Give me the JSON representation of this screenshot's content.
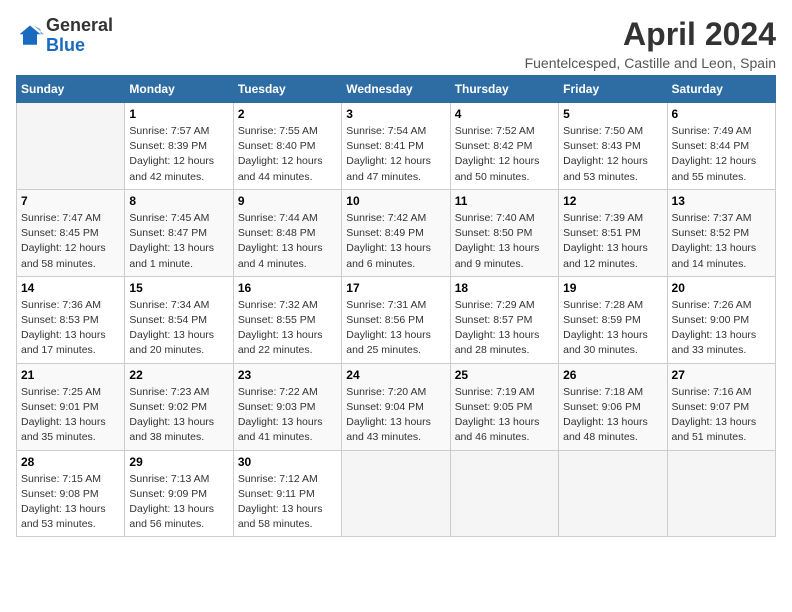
{
  "logo": {
    "general": "General",
    "blue": "Blue"
  },
  "header": {
    "title": "April 2024",
    "subtitle": "Fuentelcesped, Castille and Leon, Spain"
  },
  "weekdays": [
    "Sunday",
    "Monday",
    "Tuesday",
    "Wednesday",
    "Thursday",
    "Friday",
    "Saturday"
  ],
  "weeks": [
    [
      {
        "day": "",
        "info": ""
      },
      {
        "day": "1",
        "info": "Sunrise: 7:57 AM\nSunset: 8:39 PM\nDaylight: 12 hours\nand 42 minutes."
      },
      {
        "day": "2",
        "info": "Sunrise: 7:55 AM\nSunset: 8:40 PM\nDaylight: 12 hours\nand 44 minutes."
      },
      {
        "day": "3",
        "info": "Sunrise: 7:54 AM\nSunset: 8:41 PM\nDaylight: 12 hours\nand 47 minutes."
      },
      {
        "day": "4",
        "info": "Sunrise: 7:52 AM\nSunset: 8:42 PM\nDaylight: 12 hours\nand 50 minutes."
      },
      {
        "day": "5",
        "info": "Sunrise: 7:50 AM\nSunset: 8:43 PM\nDaylight: 12 hours\nand 53 minutes."
      },
      {
        "day": "6",
        "info": "Sunrise: 7:49 AM\nSunset: 8:44 PM\nDaylight: 12 hours\nand 55 minutes."
      }
    ],
    [
      {
        "day": "7",
        "info": "Sunrise: 7:47 AM\nSunset: 8:45 PM\nDaylight: 12 hours\nand 58 minutes."
      },
      {
        "day": "8",
        "info": "Sunrise: 7:45 AM\nSunset: 8:47 PM\nDaylight: 13 hours\nand 1 minute."
      },
      {
        "day": "9",
        "info": "Sunrise: 7:44 AM\nSunset: 8:48 PM\nDaylight: 13 hours\nand 4 minutes."
      },
      {
        "day": "10",
        "info": "Sunrise: 7:42 AM\nSunset: 8:49 PM\nDaylight: 13 hours\nand 6 minutes."
      },
      {
        "day": "11",
        "info": "Sunrise: 7:40 AM\nSunset: 8:50 PM\nDaylight: 13 hours\nand 9 minutes."
      },
      {
        "day": "12",
        "info": "Sunrise: 7:39 AM\nSunset: 8:51 PM\nDaylight: 13 hours\nand 12 minutes."
      },
      {
        "day": "13",
        "info": "Sunrise: 7:37 AM\nSunset: 8:52 PM\nDaylight: 13 hours\nand 14 minutes."
      }
    ],
    [
      {
        "day": "14",
        "info": "Sunrise: 7:36 AM\nSunset: 8:53 PM\nDaylight: 13 hours\nand 17 minutes."
      },
      {
        "day": "15",
        "info": "Sunrise: 7:34 AM\nSunset: 8:54 PM\nDaylight: 13 hours\nand 20 minutes."
      },
      {
        "day": "16",
        "info": "Sunrise: 7:32 AM\nSunset: 8:55 PM\nDaylight: 13 hours\nand 22 minutes."
      },
      {
        "day": "17",
        "info": "Sunrise: 7:31 AM\nSunset: 8:56 PM\nDaylight: 13 hours\nand 25 minutes."
      },
      {
        "day": "18",
        "info": "Sunrise: 7:29 AM\nSunset: 8:57 PM\nDaylight: 13 hours\nand 28 minutes."
      },
      {
        "day": "19",
        "info": "Sunrise: 7:28 AM\nSunset: 8:59 PM\nDaylight: 13 hours\nand 30 minutes."
      },
      {
        "day": "20",
        "info": "Sunrise: 7:26 AM\nSunset: 9:00 PM\nDaylight: 13 hours\nand 33 minutes."
      }
    ],
    [
      {
        "day": "21",
        "info": "Sunrise: 7:25 AM\nSunset: 9:01 PM\nDaylight: 13 hours\nand 35 minutes."
      },
      {
        "day": "22",
        "info": "Sunrise: 7:23 AM\nSunset: 9:02 PM\nDaylight: 13 hours\nand 38 minutes."
      },
      {
        "day": "23",
        "info": "Sunrise: 7:22 AM\nSunset: 9:03 PM\nDaylight: 13 hours\nand 41 minutes."
      },
      {
        "day": "24",
        "info": "Sunrise: 7:20 AM\nSunset: 9:04 PM\nDaylight: 13 hours\nand 43 minutes."
      },
      {
        "day": "25",
        "info": "Sunrise: 7:19 AM\nSunset: 9:05 PM\nDaylight: 13 hours\nand 46 minutes."
      },
      {
        "day": "26",
        "info": "Sunrise: 7:18 AM\nSunset: 9:06 PM\nDaylight: 13 hours\nand 48 minutes."
      },
      {
        "day": "27",
        "info": "Sunrise: 7:16 AM\nSunset: 9:07 PM\nDaylight: 13 hours\nand 51 minutes."
      }
    ],
    [
      {
        "day": "28",
        "info": "Sunrise: 7:15 AM\nSunset: 9:08 PM\nDaylight: 13 hours\nand 53 minutes."
      },
      {
        "day": "29",
        "info": "Sunrise: 7:13 AM\nSunset: 9:09 PM\nDaylight: 13 hours\nand 56 minutes."
      },
      {
        "day": "30",
        "info": "Sunrise: 7:12 AM\nSunset: 9:11 PM\nDaylight: 13 hours\nand 58 minutes."
      },
      {
        "day": "",
        "info": ""
      },
      {
        "day": "",
        "info": ""
      },
      {
        "day": "",
        "info": ""
      },
      {
        "day": "",
        "info": ""
      }
    ]
  ]
}
